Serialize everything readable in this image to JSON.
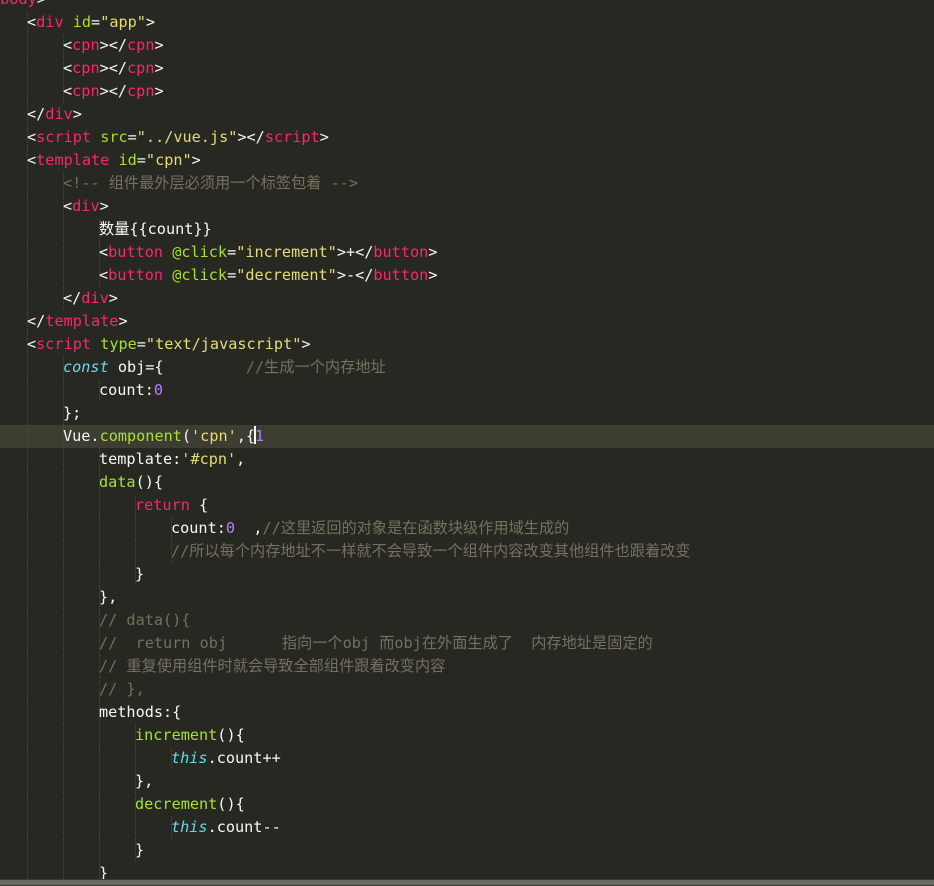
{
  "editor": {
    "theme": "dark",
    "colors": {
      "background": "#272822",
      "active_line": "#3e3d32",
      "tag": "#f92672",
      "attribute": "#a6e22e",
      "string": "#e6db74",
      "comment": "#75715e",
      "keyword": "#f92672",
      "storage": "#66d9ef",
      "number": "#ae81ff",
      "text": "#f8f8f2"
    },
    "lines": [
      {
        "indent": 1,
        "tokens": [
          [
            "t-plain",
            "<"
          ],
          [
            "t-tag",
            "body"
          ],
          [
            "t-plain",
            ">"
          ]
        ]
      },
      {
        "indent": 2,
        "tokens": [
          [
            "t-plain",
            "<"
          ],
          [
            "t-tag",
            "div"
          ],
          [
            "t-plain",
            " "
          ],
          [
            "t-attr",
            "id"
          ],
          [
            "t-plain",
            "="
          ],
          [
            "t-str",
            "\"app\""
          ],
          [
            "t-plain",
            ">"
          ]
        ]
      },
      {
        "indent": 3,
        "tokens": [
          [
            "t-plain",
            "<"
          ],
          [
            "t-tag",
            "cpn"
          ],
          [
            "t-plain",
            "></"
          ],
          [
            "t-tag",
            "cpn"
          ],
          [
            "t-plain",
            ">"
          ]
        ]
      },
      {
        "indent": 3,
        "tokens": [
          [
            "t-plain",
            "<"
          ],
          [
            "t-tag",
            "cpn"
          ],
          [
            "t-plain",
            "></"
          ],
          [
            "t-tag",
            "cpn"
          ],
          [
            "t-plain",
            ">"
          ]
        ]
      },
      {
        "indent": 3,
        "tokens": [
          [
            "t-plain",
            "<"
          ],
          [
            "t-tag",
            "cpn"
          ],
          [
            "t-plain",
            "></"
          ],
          [
            "t-tag",
            "cpn"
          ],
          [
            "t-plain",
            ">"
          ]
        ]
      },
      {
        "indent": 2,
        "tokens": [
          [
            "t-plain",
            "</"
          ],
          [
            "t-tag",
            "div"
          ],
          [
            "t-plain",
            ">"
          ]
        ]
      },
      {
        "indent": 2,
        "tokens": [
          [
            "t-plain",
            "<"
          ],
          [
            "t-tag",
            "script"
          ],
          [
            "t-plain",
            " "
          ],
          [
            "t-attr",
            "src"
          ],
          [
            "t-plain",
            "="
          ],
          [
            "t-str",
            "\"../vue.js\""
          ],
          [
            "t-plain",
            "></"
          ],
          [
            "t-tag",
            "script"
          ],
          [
            "t-plain",
            ">"
          ]
        ]
      },
      {
        "indent": 2,
        "tokens": [
          [
            "t-plain",
            "<"
          ],
          [
            "t-tag",
            "template"
          ],
          [
            "t-plain",
            " "
          ],
          [
            "t-attr",
            "id"
          ],
          [
            "t-plain",
            "="
          ],
          [
            "t-str",
            "\"cpn\""
          ],
          [
            "t-plain",
            ">"
          ]
        ]
      },
      {
        "indent": 3,
        "tokens": [
          [
            "t-cmt",
            "<!-- 组件最外层必须用一个标签包着 -->"
          ]
        ]
      },
      {
        "indent": 3,
        "tokens": [
          [
            "t-plain",
            "<"
          ],
          [
            "t-tag",
            "div"
          ],
          [
            "t-plain",
            ">"
          ]
        ]
      },
      {
        "indent": 4,
        "tokens": [
          [
            "t-plain",
            "数量{{count}}"
          ]
        ]
      },
      {
        "indent": 4,
        "tokens": [
          [
            "t-plain",
            "<"
          ],
          [
            "t-tag",
            "button"
          ],
          [
            "t-plain",
            " "
          ],
          [
            "t-attr",
            "@click"
          ],
          [
            "t-plain",
            "="
          ],
          [
            "t-str",
            "\"increment\""
          ],
          [
            "t-plain",
            ">+</"
          ],
          [
            "t-tag",
            "button"
          ],
          [
            "t-plain",
            ">"
          ]
        ]
      },
      {
        "indent": 4,
        "tokens": [
          [
            "t-plain",
            "<"
          ],
          [
            "t-tag",
            "button"
          ],
          [
            "t-plain",
            " "
          ],
          [
            "t-attr",
            "@click"
          ],
          [
            "t-plain",
            "="
          ],
          [
            "t-str",
            "\"decrement\""
          ],
          [
            "t-plain",
            ">-</"
          ],
          [
            "t-tag",
            "button"
          ],
          [
            "t-plain",
            ">"
          ]
        ]
      },
      {
        "indent": 3,
        "tokens": [
          [
            "t-plain",
            "</"
          ],
          [
            "t-tag",
            "div"
          ],
          [
            "t-plain",
            ">"
          ]
        ]
      },
      {
        "indent": 2,
        "tokens": [
          [
            "t-plain",
            "</"
          ],
          [
            "t-tag",
            "template"
          ],
          [
            "t-plain",
            ">"
          ]
        ]
      },
      {
        "indent": 2,
        "tokens": [
          [
            "t-plain",
            "<"
          ],
          [
            "t-tag",
            "script"
          ],
          [
            "t-plain",
            " "
          ],
          [
            "t-attr",
            "type"
          ],
          [
            "t-plain",
            "="
          ],
          [
            "t-str",
            "\"text/javascript\""
          ],
          [
            "t-plain",
            ">"
          ]
        ]
      },
      {
        "indent": 3,
        "tokens": [
          [
            "t-stor",
            "const"
          ],
          [
            "t-plain",
            " obj={         "
          ],
          [
            "t-cmt",
            "//生成一个内存地址"
          ]
        ]
      },
      {
        "indent": 4,
        "tokens": [
          [
            "t-plain",
            "count:"
          ],
          [
            "t-num",
            "0"
          ]
        ]
      },
      {
        "indent": 3,
        "tokens": [
          [
            "t-plain",
            "};"
          ]
        ]
      },
      {
        "indent": 3,
        "active": true,
        "tokens": [
          [
            "t-plain",
            "Vue."
          ],
          [
            "t-fn",
            "component"
          ],
          [
            "t-plain",
            "("
          ],
          [
            "t-str",
            "'cpn'"
          ],
          [
            "t-plain",
            ",{"
          ],
          [
            "caret",
            ""
          ],
          [
            "t-num",
            "1"
          ]
        ]
      },
      {
        "indent": 4,
        "tokens": [
          [
            "t-plain",
            "template:"
          ],
          [
            "t-str",
            "'#cpn'"
          ],
          [
            "t-plain",
            ","
          ]
        ]
      },
      {
        "indent": 4,
        "tokens": [
          [
            "t-fn",
            "data"
          ],
          [
            "t-plain",
            "(){"
          ]
        ]
      },
      {
        "indent": 5,
        "tokens": [
          [
            "t-kw",
            "return"
          ],
          [
            "t-plain",
            " {"
          ]
        ]
      },
      {
        "indent": 6,
        "tokens": [
          [
            "t-plain",
            "count:"
          ],
          [
            "t-num",
            "0"
          ],
          [
            "t-plain",
            "  ,"
          ],
          [
            "t-cmt",
            "//这里返回的对象是在函数块级作用域生成的"
          ]
        ]
      },
      {
        "indent": 6,
        "tokens": [
          [
            "t-cmt",
            "//所以每个内存地址不一样就不会导致一个组件内容改变其他组件也跟着改变"
          ]
        ]
      },
      {
        "indent": 5,
        "tokens": [
          [
            "t-plain",
            "}"
          ]
        ]
      },
      {
        "indent": 4,
        "tokens": [
          [
            "t-plain",
            "},"
          ]
        ]
      },
      {
        "indent": 4,
        "tokens": [
          [
            "t-cmt",
            "// data(){"
          ]
        ]
      },
      {
        "indent": 4,
        "tokens": [
          [
            "t-cmt",
            "//  return obj      指向一个obj 而obj在外面生成了  内存地址是固定的"
          ]
        ]
      },
      {
        "indent": 4,
        "tokens": [
          [
            "t-cmt",
            "// 重复使用组件时就会导致全部组件跟着改变内容"
          ]
        ]
      },
      {
        "indent": 4,
        "tokens": [
          [
            "t-cmt",
            "// },"
          ]
        ]
      },
      {
        "indent": 4,
        "tokens": [
          [
            "t-plain",
            "methods:{"
          ]
        ]
      },
      {
        "indent": 5,
        "tokens": [
          [
            "t-fn",
            "increment"
          ],
          [
            "t-plain",
            "(){"
          ]
        ]
      },
      {
        "indent": 6,
        "tokens": [
          [
            "t-stor",
            "this"
          ],
          [
            "t-plain",
            ".count++"
          ]
        ]
      },
      {
        "indent": 5,
        "tokens": [
          [
            "t-plain",
            "},"
          ]
        ]
      },
      {
        "indent": 5,
        "tokens": [
          [
            "t-fn",
            "decrement"
          ],
          [
            "t-plain",
            "(){"
          ]
        ]
      },
      {
        "indent": 6,
        "tokens": [
          [
            "t-stor",
            "this"
          ],
          [
            "t-plain",
            ".count--"
          ]
        ]
      },
      {
        "indent": 5,
        "tokens": [
          [
            "t-plain",
            "}"
          ]
        ]
      },
      {
        "indent": 4,
        "tokens": [
          [
            "t-plain",
            "}"
          ]
        ]
      }
    ]
  }
}
